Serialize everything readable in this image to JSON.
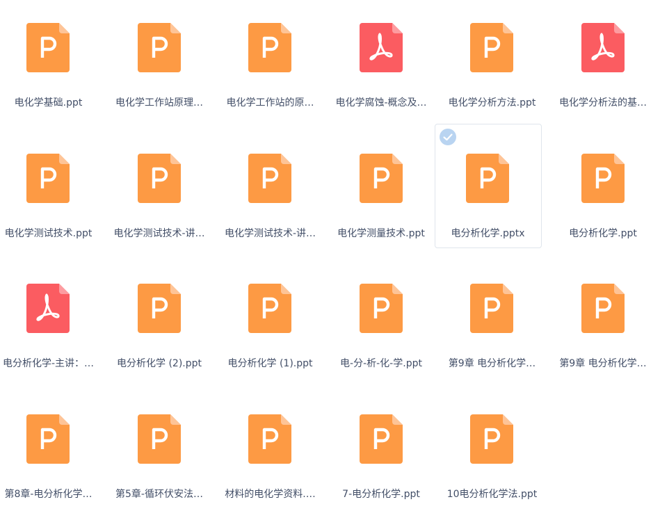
{
  "colors": {
    "ppt": "#fd9a44",
    "ppt_fold": "#fec497",
    "pdf": "#fb5c61",
    "pdf_fold": "#fd9ca0",
    "text": "#424e67",
    "selected_border": "#dfe5ec",
    "check": "#b9d4f1"
  },
  "icons": {
    "ppt": "ppt-file-icon",
    "pdf": "pdf-file-icon",
    "check": "check-circle-icon"
  },
  "files": [
    {
      "name": "电化学基础.ppt",
      "type": "ppt",
      "selected": false
    },
    {
      "name": "电化学工作站原理…",
      "type": "ppt",
      "selected": false
    },
    {
      "name": "电化学工作站的原…",
      "type": "ppt",
      "selected": false
    },
    {
      "name": "电化学腐蚀-概念及…",
      "type": "pdf",
      "selected": false
    },
    {
      "name": "电化学分析方法.ppt",
      "type": "ppt",
      "selected": false
    },
    {
      "name": "电化学分析法的基…",
      "type": "pdf",
      "selected": false
    },
    {
      "name": "电化学测试技术.ppt",
      "type": "ppt",
      "selected": false
    },
    {
      "name": "电化学测试技术-讲…",
      "type": "ppt",
      "selected": false
    },
    {
      "name": "电化学测试技术-讲…",
      "type": "ppt",
      "selected": false
    },
    {
      "name": "电化学测量技术.ppt",
      "type": "ppt",
      "selected": false
    },
    {
      "name": "电分析化学.pptx",
      "type": "ppt",
      "selected": true
    },
    {
      "name": "电分析化学.ppt",
      "type": "ppt",
      "selected": false
    },
    {
      "name": "电分析化学-主讲：…",
      "type": "pdf",
      "selected": false
    },
    {
      "name": "电分析化学 (2).ppt",
      "type": "ppt",
      "selected": false
    },
    {
      "name": "电分析化学 (1).ppt",
      "type": "ppt",
      "selected": false
    },
    {
      "name": "电-分-析-化-学.ppt",
      "type": "ppt",
      "selected": false
    },
    {
      "name": "第9章 电分析化学…",
      "type": "ppt",
      "selected": false
    },
    {
      "name": "第9章 电分析化学…",
      "type": "ppt",
      "selected": false
    },
    {
      "name": "第8章-电分析化学…",
      "type": "ppt",
      "selected": false
    },
    {
      "name": "第5章-循环伏安法…",
      "type": "ppt",
      "selected": false
    },
    {
      "name": "材料的电化学资料.…",
      "type": "ppt",
      "selected": false
    },
    {
      "name": "7-电分析化学.ppt",
      "type": "ppt",
      "selected": false
    },
    {
      "name": "10电分析化学法.ppt",
      "type": "ppt",
      "selected": false
    }
  ]
}
